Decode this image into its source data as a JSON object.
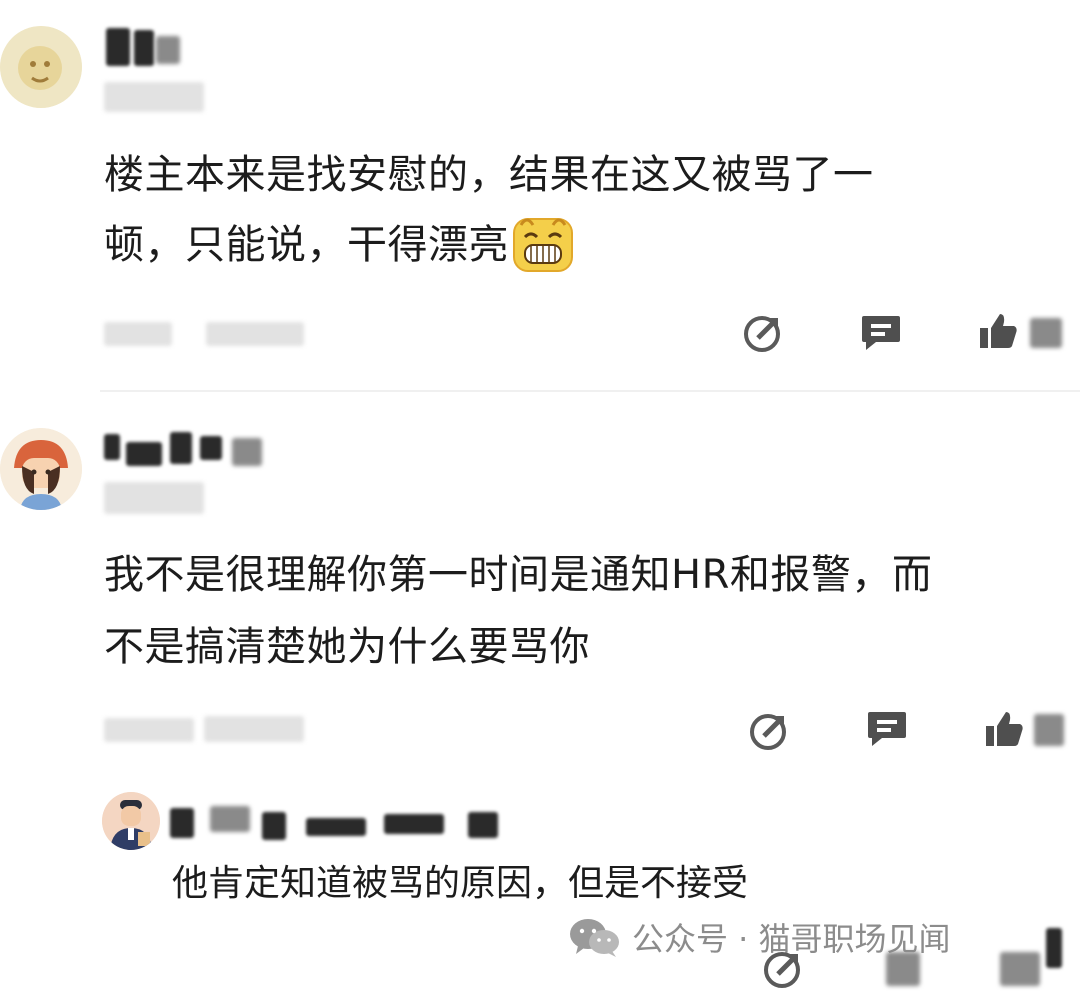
{
  "comments": [
    {
      "text_line1": "楼主本来是找安慰的，结果在这又被骂了一",
      "text_line2": "顿，只能说，干得漂亮",
      "emoji": "grin-emoji"
    },
    {
      "text_line1": "我不是很理解你第一时间是通知HR和报警，而",
      "text_line2": "不是搞清楚她为什么要骂你",
      "reply": {
        "text": "他肯定知道被骂的原因，但是不接受"
      }
    }
  ],
  "watermark": {
    "label": "公众号 · 猫哥职场见闻",
    "icon": "wechat-icon"
  },
  "icons": {
    "share": "share-icon",
    "comment": "comment-icon",
    "like": "thumbs-up-icon"
  },
  "colors": {
    "icon": "#5a5a5a",
    "watermark": "#8c8c8c",
    "text": "#1c1c1c"
  }
}
